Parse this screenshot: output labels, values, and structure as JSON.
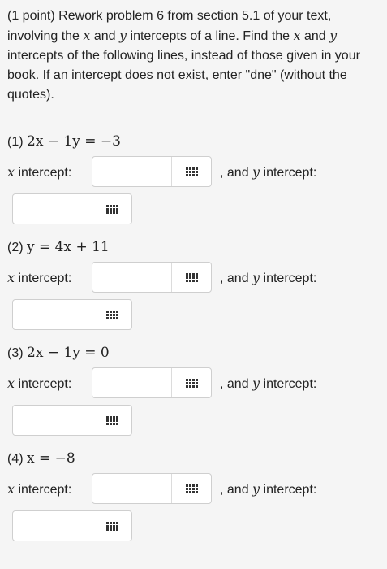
{
  "intro": {
    "t1": "(1 point) Rework problem 6 from section 5.1 of your text, involving the ",
    "x": "x",
    "t2": " and ",
    "y": "y",
    "t3": " intercepts of a line. Find the ",
    "x2": "x",
    "t4": " and ",
    "y2": "y",
    "t5": " intercepts of the following lines, instead of those given in your book. If an intercept does not exist, enter \"dne\" (without the quotes)."
  },
  "labels": {
    "x_intercept_var": "x",
    "x_intercept_text": " intercept:",
    "and_text": ", and ",
    "y_var": "y",
    "y_intercept_text": " intercept:"
  },
  "problems": [
    {
      "num": "(1) ",
      "equation": "2x − 1y = −3",
      "x_value": "",
      "y_value": ""
    },
    {
      "num": "(2) ",
      "equation": "y = 4x + 11",
      "x_value": "",
      "y_value": ""
    },
    {
      "num": "(3) ",
      "equation": "2x − 1y = 0",
      "x_value": "",
      "y_value": ""
    },
    {
      "num": "(4) ",
      "equation": "x = −8",
      "x_value": "",
      "y_value": ""
    }
  ],
  "icons": {
    "palette": "grid-icon"
  }
}
